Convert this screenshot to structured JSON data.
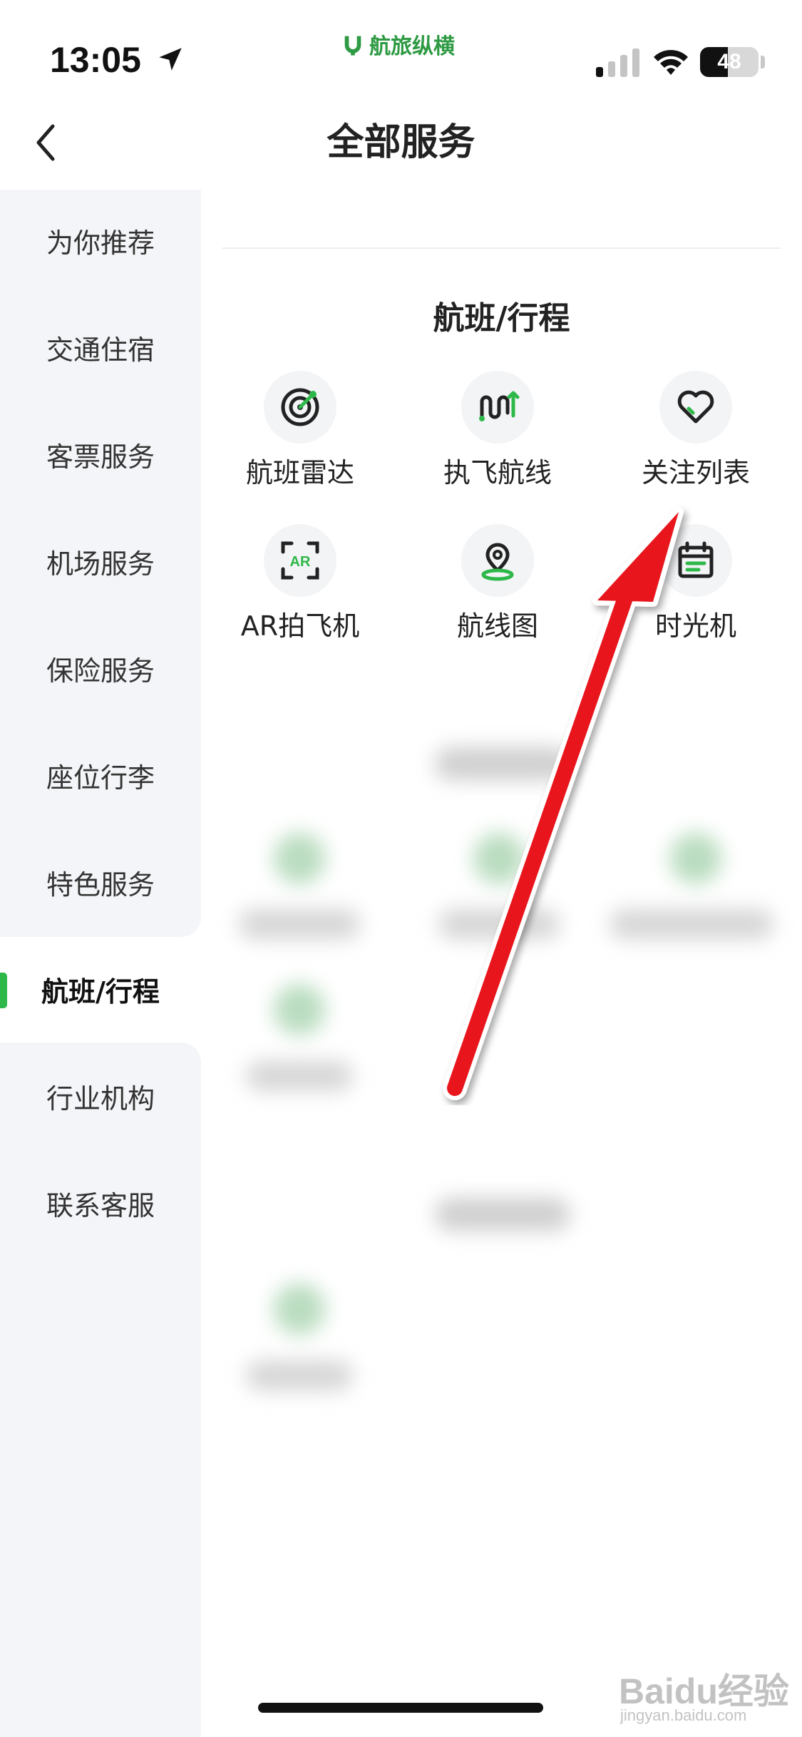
{
  "status_bar": {
    "time": "13:05",
    "battery": "48",
    "battery_level": 0.48,
    "brand": "航旅纵横",
    "brand_color": "#2e9a43"
  },
  "header": {
    "title": "全部服务",
    "back_icon": "chevron-left-icon"
  },
  "sidebar": {
    "active_color": "#2eb84a",
    "items": [
      {
        "label": "为你推荐"
      },
      {
        "label": "交通住宿"
      },
      {
        "label": "客票服务"
      },
      {
        "label": "机场服务"
      },
      {
        "label": "保险服务"
      },
      {
        "label": "座位行李"
      },
      {
        "label": "特色服务"
      },
      {
        "label": "航班/行程",
        "active": true
      },
      {
        "label": "行业机构"
      },
      {
        "label": "联系客服"
      }
    ]
  },
  "main": {
    "section_title": "航班/行程",
    "services": [
      {
        "label": "航班雷达",
        "icon": "radar-icon"
      },
      {
        "label": "执飞航线",
        "icon": "route-icon"
      },
      {
        "label": "关注列表",
        "icon": "heart-icon"
      },
      {
        "label": "AR拍飞机",
        "icon": "ar-icon"
      },
      {
        "label": "航线图",
        "icon": "map-pin-icon"
      },
      {
        "label": "时光机",
        "icon": "calendar-icon"
      }
    ]
  },
  "annotation": {
    "arrow_color": "#e8141c"
  },
  "watermark": {
    "text": "Baidu经验",
    "sub": "jingyan.baidu.com"
  }
}
